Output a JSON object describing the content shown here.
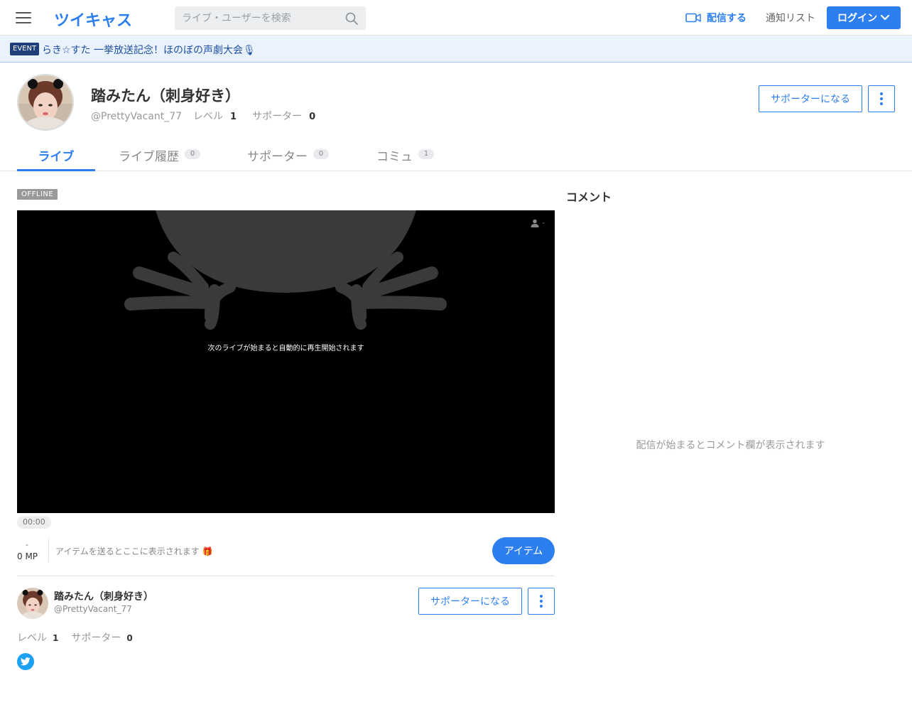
{
  "header": {
    "logo": "ツイキャス",
    "search_placeholder": "ライブ・ユーザーを検索",
    "broadcast_label": "配信する",
    "notify_label": "通知リスト",
    "login_label": "ログイン"
  },
  "event": {
    "badge": "EVENT",
    "text": "らき☆すた 一挙放送記念！ほのぼの声劇大会🎙"
  },
  "profile": {
    "name": "踏みたん（刺身好き）",
    "handle": "@PrettyVacant_77",
    "level_label": "レベル",
    "level": "1",
    "supporter_label": "サポーター",
    "supporters": "0",
    "support_button": "サポーターになる"
  },
  "tabs": [
    {
      "label": "ライブ",
      "count": ""
    },
    {
      "label": "ライブ履歴",
      "count": "0"
    },
    {
      "label": "サポーター",
      "count": "0"
    },
    {
      "label": "コミュ",
      "count": "1"
    }
  ],
  "player": {
    "status": "OFFLINE",
    "viewers": "-",
    "message": "次のライブが始まると自動的に再生開始されます",
    "time": "00:00"
  },
  "items": {
    "mp_dash": "-",
    "mp_value": "0 MP",
    "message": "アイテムを送るとここに表示されます 🎁",
    "button": "アイテム"
  },
  "bottom_profile": {
    "name": "踏みたん（刺身好き）",
    "handle": "@PrettyVacant_77",
    "level_label": "レベル",
    "level": "1",
    "supporter_label": "サポーター",
    "supporters": "0",
    "support_button": "サポーターになる"
  },
  "comments": {
    "title": "コメント",
    "empty_message": "配信が始まるとコメント欄が表示されます"
  },
  "icons": {
    "menu": "hamburger-menu-icon",
    "search": "search-icon",
    "broadcast": "video-camera-icon",
    "login_chevron": "chevron-down-icon",
    "more": "kebab-menu-icon",
    "viewer": "person-icon",
    "twitter": "twitter-bird-icon"
  },
  "colors": {
    "accent": "#2d7ff0",
    "event_bg": "#eaf3fd",
    "twitter": "#1da1f2"
  }
}
